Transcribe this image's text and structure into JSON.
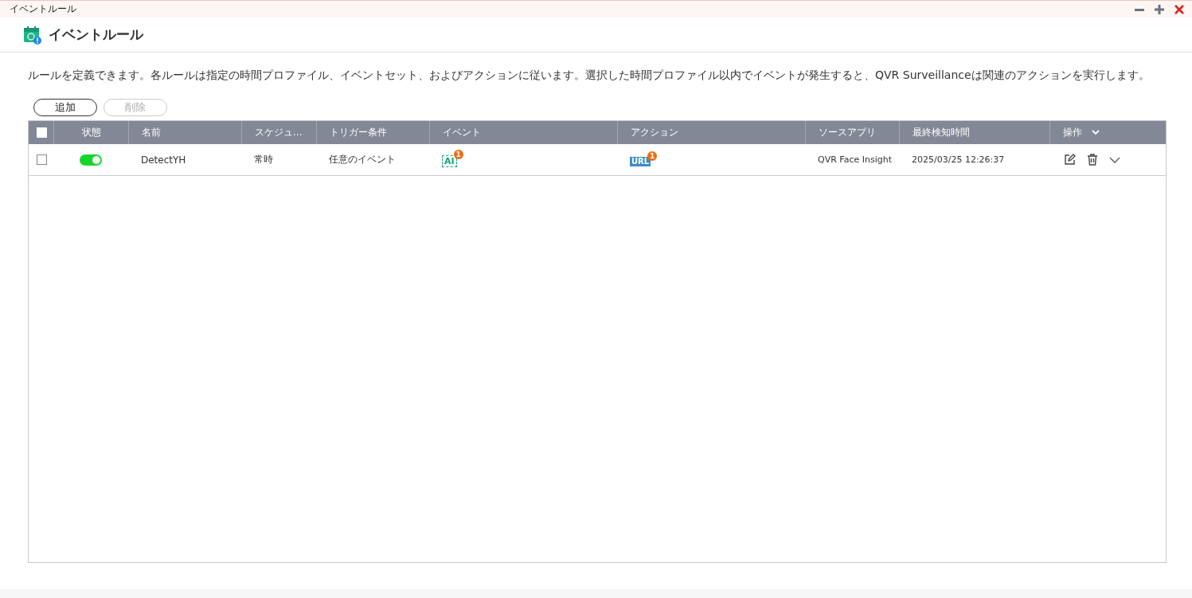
{
  "window": {
    "title": "イベントルール"
  },
  "header": {
    "title": "イベントルール"
  },
  "description": "ルールを定義できます。各ルールは指定の時間プロファイル、イベントセット、およびアクションに従います。選択した時間プロファイル以内でイベントが発生すると、QVR Surveillanceは関連のアクションを実行します。",
  "buttons": [
    {
      "label": "追加",
      "disabled": false
    },
    {
      "label": "削除",
      "disabled": true
    }
  ],
  "table": {
    "select_all_checked": false,
    "columns": [
      "状態",
      "名前",
      "スケジュ...",
      "トリガー条件",
      "イベント",
      "アクション",
      "ソースアプリ",
      "最終検知時間",
      "操作"
    ],
    "rows": [
      {
        "checked": false,
        "on": true,
        "name": "DetectYH",
        "schedule": "常時",
        "trigger": "任意のイベント",
        "event": {
          "label": "AI",
          "badge": "1"
        },
        "action": {
          "label": "URL",
          "badge": "1"
        },
        "source_app": "QVR Face Insight",
        "last_detected": "2025/03/25 12:26:37"
      }
    ]
  }
}
